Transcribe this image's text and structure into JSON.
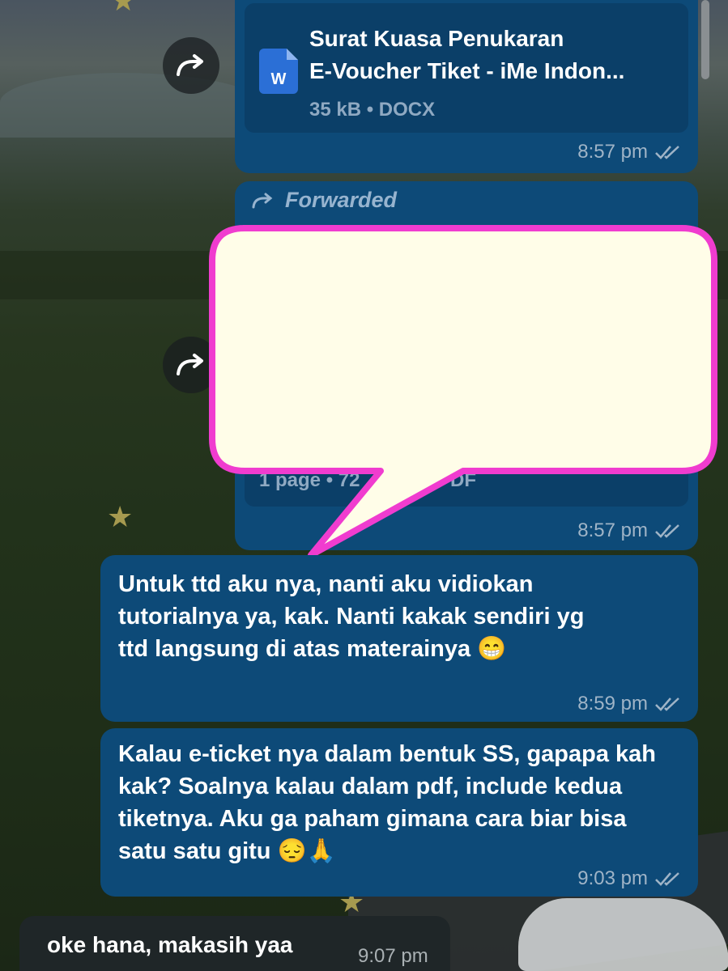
{
  "messages": {
    "file_msg": {
      "file_name": "Surat Kuasa Penukaran E-Voucher Tiket - iMe Indon...",
      "file_name_line1": "Surat Kuasa Penukaran",
      "file_name_line2": "E-Voucher Tiket - iMe Indon...",
      "file_meta": "35 kB • DOCX",
      "file_icon_letter": "W",
      "time": "8:57 pm"
    },
    "pdf_msg": {
      "forwarded_label": "Forwarded",
      "file_meta_visible": "1 page • 72",
      "file_meta_tail": "DF",
      "time": "8:57 pm"
    },
    "msg3": {
      "text": "Untuk ttd aku nya, nanti aku vidiokan tutorialnya ya, kak. Nanti kakak sendiri yg ttd langsung di atas materainya 😁",
      "time": "8:59 pm"
    },
    "msg4": {
      "text": "Kalau e-ticket nya dalam bentuk SS, gapapa kah kak? Soalnya kalau dalam pdf, include kedua tiketnya. Aku ga paham gimana cara biar bisa satu satu gitu 😔🙏",
      "time": "9:03 pm"
    },
    "msg5": {
      "text": "oke hana, makasih yaa",
      "time": "9:07 pm"
    }
  },
  "icons": {
    "forward": "forward-arrow-icon",
    "read_receipt": "double-check-icon",
    "star": "star-icon",
    "docx": "docx-file-icon"
  },
  "colors": {
    "outgoing_bubble": "#0d4a78",
    "incoming_bubble": "#1f2628",
    "callout_fill": "#fffde8",
    "callout_border": "#f03ccf"
  }
}
